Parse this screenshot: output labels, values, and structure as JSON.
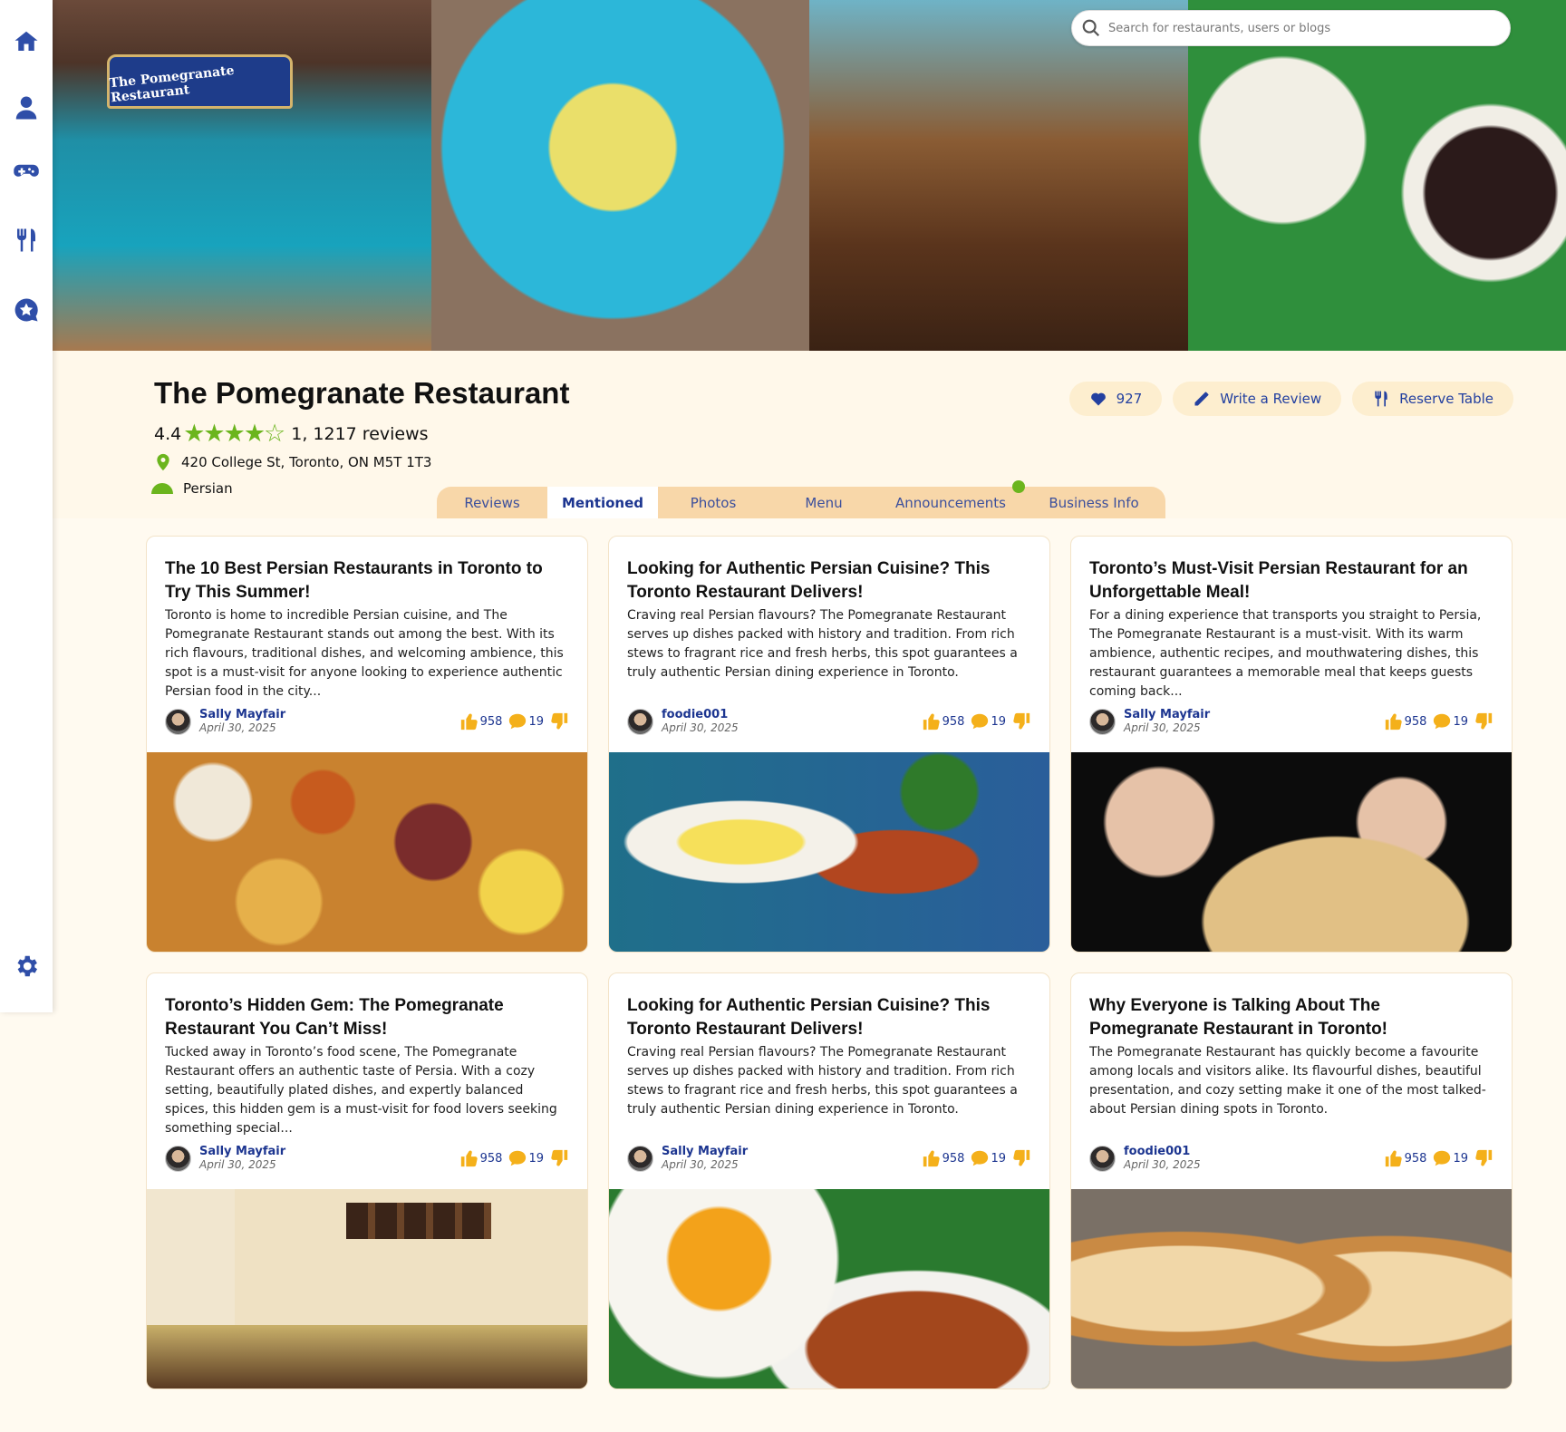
{
  "sidebar": {
    "icons": [
      "home-icon",
      "user-icon",
      "gamepad-icon",
      "utensils-icon",
      "star-chat-icon",
      "gear-icon"
    ],
    "icon_color": "#2f4ea8"
  },
  "search": {
    "placeholder": "Search for restaurants, users or blogs"
  },
  "banner": {
    "sign_text": "The Pomegranate Restaurant"
  },
  "restaurant": {
    "name": "The Pomegranate Restaurant",
    "rating": "4.4",
    "rating_value": 4.4,
    "stars": "★★★★☆",
    "reviews": "1, 1217 reviews",
    "address": "420 College St, Toronto, ON M5T 1T3",
    "cuisine": "Persian",
    "accent_color": "#6bb51d"
  },
  "actions": {
    "likes": "927",
    "write_review": "Write a Review",
    "reserve": "Reserve Table"
  },
  "tabs": [
    {
      "label": "Reviews",
      "active": false
    },
    {
      "label": "Mentioned",
      "active": true
    },
    {
      "label": "Photos",
      "active": false
    },
    {
      "label": "Menu",
      "active": false
    },
    {
      "label": "Announcements",
      "active": false
    },
    {
      "label": "Business Info",
      "active": false
    }
  ],
  "posts": [
    {
      "title": "The 10 Best Persian Restaurants in Toronto to Try This Summer!",
      "excerpt": "Toronto is home to incredible Persian cuisine, and The Pomegranate Restaurant stands out among the best. With its rich flavours, traditional dishes, and welcoming ambience, this spot is a must-visit for anyone looking to experience authentic Persian food in the city...",
      "author": "Sally Mayfair",
      "date": "April 30, 2025",
      "likes": "958",
      "comments": "19"
    },
    {
      "title": "Looking for Authentic Persian Cuisine? This Toronto Restaurant Delivers!",
      "excerpt": "Craving real Persian flavours? The Pomegranate Restaurant serves up dishes packed with history and tradition. From rich stews to fragrant rice and fresh herbs, this spot guarantees a truly authentic Persian dining experience in Toronto.",
      "author": "foodie001",
      "date": "April 30, 2025",
      "likes": "958",
      "comments": "19"
    },
    {
      "title": "Toronto’s Must-Visit Persian Restaurant for an Unforgettable Meal!",
      "excerpt": "For a dining experience that transports you straight to Persia, The Pomegranate Restaurant is a must-visit. With its warm ambience, authentic recipes, and mouthwatering dishes, this restaurant guarantees a memorable meal that keeps guests coming back...",
      "author": "Sally Mayfair",
      "date": "April 30, 2025",
      "likes": "958",
      "comments": "19"
    },
    {
      "title": "Toronto’s Hidden Gem: The Pomegranate Restaurant You Can’t Miss!",
      "excerpt": "Tucked away in Toronto’s food scene, The Pomegranate Restaurant offers an authentic taste of Persia. With a cozy setting, beautifully plated dishes, and expertly balanced spices, this hidden gem is a must-visit for food lovers seeking something special...",
      "author": "Sally Mayfair",
      "date": "April 30, 2025",
      "likes": "958",
      "comments": "19"
    },
    {
      "title": "Looking for Authentic Persian Cuisine? This Toronto Restaurant Delivers!",
      "excerpt": "Craving real Persian flavours? The Pomegranate Restaurant serves up dishes packed with history and tradition. From rich stews to fragrant rice and fresh herbs, this spot guarantees a truly authentic Persian dining experience in Toronto.",
      "author": "Sally Mayfair",
      "date": "April 30, 2025",
      "likes": "958",
      "comments": "19"
    },
    {
      "title": "Why Everyone is Talking About The Pomegranate Restaurant in Toronto!",
      "excerpt": "The Pomegranate Restaurant has quickly become a favourite among locals and visitors alike. Its flavourful dishes, beautiful presentation, and cozy setting make it one of the most talked-about Persian dining spots in Toronto.",
      "author": "foodie001",
      "date": "April 30, 2025",
      "likes": "958",
      "comments": "19"
    }
  ]
}
